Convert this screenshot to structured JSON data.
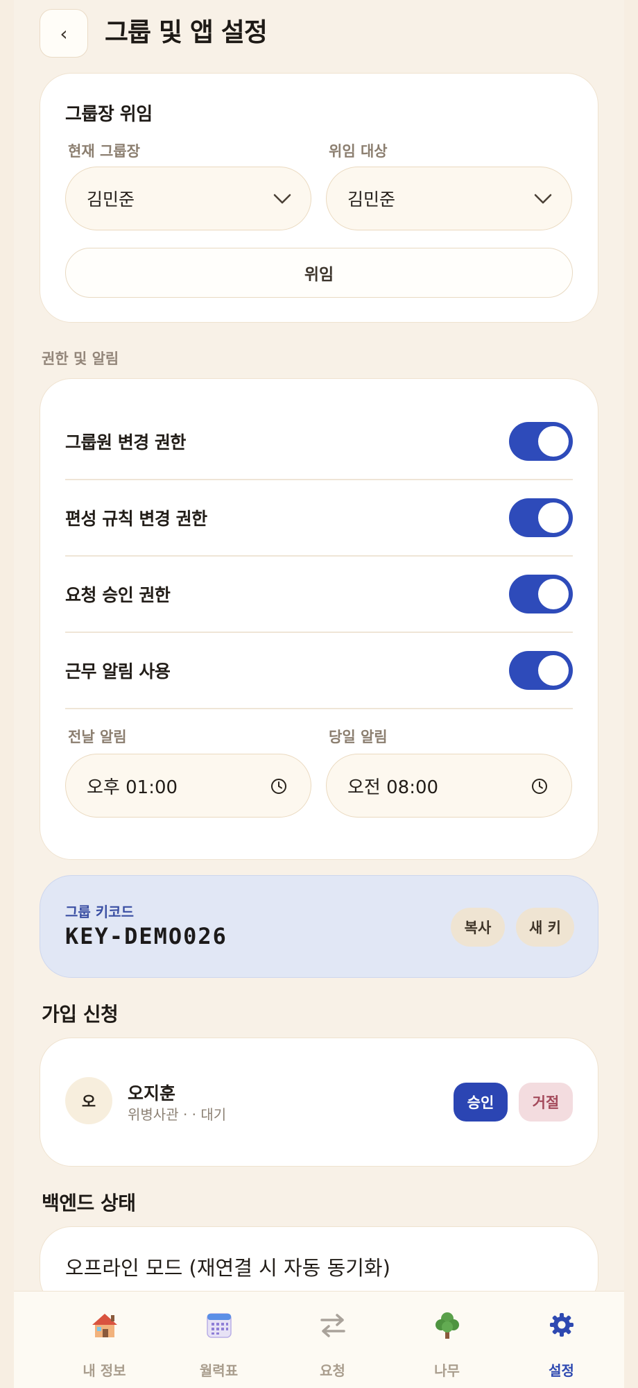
{
  "header": {
    "back_label": "‹",
    "title": "그룹 및 앱 설정"
  },
  "delegate_card": {
    "title": "그룹장 위임",
    "current_label": "현재 그룹장",
    "current_value": "김민준",
    "target_label": "위임 대상",
    "target_value": "김민준",
    "button_label": "위임"
  },
  "permissions": {
    "section_label": "권한 및 알림",
    "rows": [
      {
        "label": "그룹원 변경 권한",
        "on": true
      },
      {
        "label": "편성 규칙 변경 권한",
        "on": true
      },
      {
        "label": "요청 승인 권한",
        "on": true
      },
      {
        "label": "근무 알림 사용",
        "on": true
      }
    ],
    "prev_day_label": "전날 알림",
    "prev_day_value": "오후 01:00",
    "same_day_label": "당일 알림",
    "same_day_value": "오전 08:00"
  },
  "group_key": {
    "label": "그룹 키코드",
    "value": "KEY-DEMO026",
    "copy_label": "복사",
    "new_key_label": "새 키"
  },
  "join_requests": {
    "heading": "가입 신청",
    "items": [
      {
        "avatar": "오",
        "name": "오지훈",
        "sub": "위병사관 · · 대기",
        "approve": "승인",
        "reject": "거절"
      }
    ]
  },
  "backend": {
    "heading": "백엔드 상태",
    "status_text": "오프라인 모드 (재연결 시 자동 동기화)"
  },
  "bottom_nav": {
    "items": [
      {
        "label": "내 정보",
        "icon": "house-icon"
      },
      {
        "label": "월력표",
        "icon": "calendar-icon"
      },
      {
        "label": "요청",
        "icon": "swap-arrows-icon"
      },
      {
        "label": "나무",
        "icon": "tree-icon"
      },
      {
        "label": "설정",
        "icon": "gear-icon",
        "active": true
      }
    ]
  },
  "colors": {
    "accent": "#2e4bba",
    "background": "#f7eee2",
    "key_card": "#e1e7f5",
    "reject": "#f3dcdf"
  }
}
